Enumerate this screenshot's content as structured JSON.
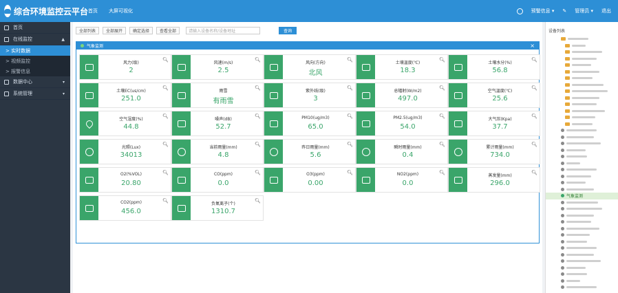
{
  "header": {
    "app_title": "综合环境监控云平台",
    "links": [
      "首页",
      "大屏可视化"
    ],
    "right_items": [
      "预警信息 ▾",
      "管理员 ▾",
      "退出"
    ]
  },
  "sidebar": {
    "items": [
      {
        "label": "首页"
      },
      {
        "label": "在线监控",
        "caret": "▲"
      },
      {
        "label": "实时数据",
        "sub": true,
        "active": true
      },
      {
        "label": "视频监控",
        "sub": true
      },
      {
        "label": "报警信息",
        "sub": true
      },
      {
        "label": "数据中心",
        "caret": "▾"
      },
      {
        "label": "系统管理",
        "caret": "▾"
      }
    ]
  },
  "toolbar": {
    "buttons": [
      "全部列表",
      "全部展开",
      "确定选择",
      "查看全部"
    ],
    "search_placeholder": "请输入设备名称/设备地址",
    "search_label": "查询"
  },
  "panel": {
    "title": "气象监测",
    "close": "×"
  },
  "sensors": [
    {
      "name": "风力(级)",
      "value": "2",
      "icon": "device-icon"
    },
    {
      "name": "风速(m/s)",
      "value": "2.5",
      "icon": "wind-icon"
    },
    {
      "name": "风向(方向)",
      "value": "北风",
      "icon": "flag-icon"
    },
    {
      "name": "土壤温度(℃)",
      "value": "18.3",
      "icon": "device-icon"
    },
    {
      "name": "土壤水分(%)",
      "value": "56.8",
      "icon": "device-icon"
    },
    {
      "name": "土壤EC(us/cm)",
      "value": "251.0",
      "icon": "device-icon"
    },
    {
      "name": "雨雪",
      "value": "有雨雪",
      "icon": "device-icon"
    },
    {
      "name": "紫外线(级)",
      "value": "3",
      "icon": "device-icon"
    },
    {
      "name": "总辐射(W/m2)",
      "value": "497.0",
      "icon": "device-icon"
    },
    {
      "name": "空气温度(℃)",
      "value": "25.6",
      "icon": "device-icon"
    },
    {
      "name": "空气湿度(%)",
      "value": "44.8",
      "icon": "drop-icon"
    },
    {
      "name": "噪声(dB)",
      "value": "52.7",
      "icon": "device-icon"
    },
    {
      "name": "PM10(ug/m3)",
      "value": "65.0",
      "icon": "dust-icon"
    },
    {
      "name": "PM2.5(ug/m3)",
      "value": "54.0",
      "icon": "dust-icon"
    },
    {
      "name": "大气压(Kpa)",
      "value": "37.7",
      "icon": "pressure-icon"
    },
    {
      "name": "光照(Lux)",
      "value": "34013",
      "icon": "sun-icon"
    },
    {
      "name": "当前雨量(mm)",
      "value": "4.8",
      "icon": "cloud-icon"
    },
    {
      "name": "昨日雨量(mm)",
      "value": "5.6",
      "icon": "cloud-icon"
    },
    {
      "name": "瞬时雨量(mm)",
      "value": "0.4",
      "icon": "cloud-icon"
    },
    {
      "name": "累计雨量(mm)",
      "value": "734.0",
      "icon": "cloud-icon"
    },
    {
      "name": "O2(%VOL)",
      "value": "20.80",
      "icon": "device-icon"
    },
    {
      "name": "CO(ppm)",
      "value": "0.0",
      "icon": "device-icon"
    },
    {
      "name": "O3(ppm)",
      "value": "0.00",
      "icon": "device-icon"
    },
    {
      "name": "NO2(ppm)",
      "value": "0.0",
      "icon": "device-icon"
    },
    {
      "name": "蒸发量(mm)",
      "value": "296.0",
      "icon": "device-icon"
    },
    {
      "name": "CO2(ppm)",
      "value": "456.0",
      "icon": "device-icon"
    },
    {
      "name": "负氧离子(个)",
      "value": "1310.7",
      "icon": "device-icon"
    }
  ],
  "device_tree": {
    "title": "设备列表",
    "selected": "气象监测"
  },
  "colors": {
    "primary": "#2d8fd6",
    "sidebar": "#2b3643",
    "card_icon": "#3aa56a",
    "value": "#3aa56a"
  }
}
